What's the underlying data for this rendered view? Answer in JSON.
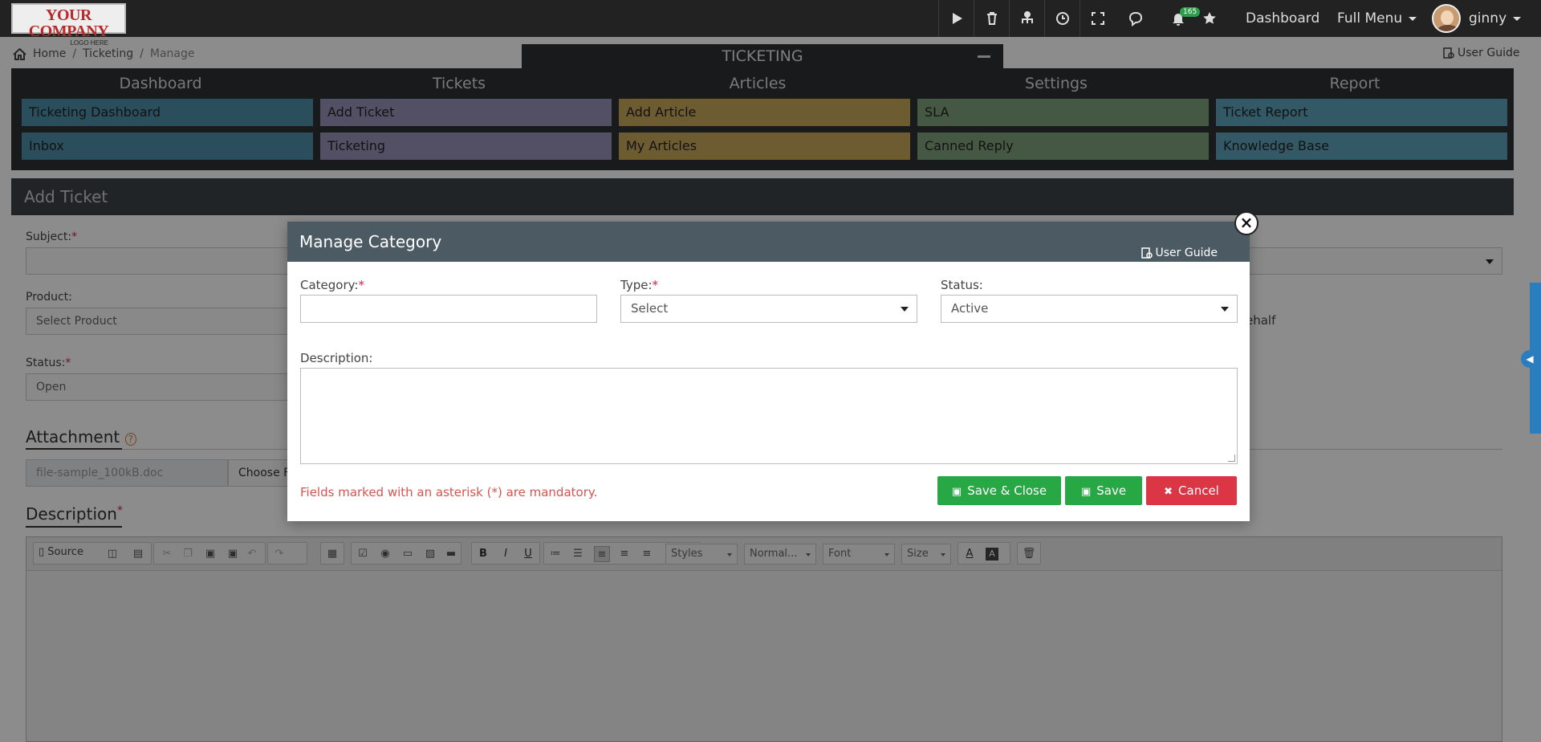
{
  "topbar": {
    "logo_line1": "YOUR COMPANY",
    "logo_line2": "LOGO HERE",
    "notification_count": "165",
    "dashboard_link": "Dashboard",
    "full_menu": "Full Menu",
    "username": "ginny"
  },
  "breadcrumb": {
    "home": "Home",
    "ticketing": "Ticketing",
    "current": "Manage"
  },
  "user_guide": "User Guide",
  "module_title": "TICKETING",
  "menu": {
    "columns": [
      "Dashboard",
      "Tickets",
      "Articles",
      "Settings",
      "Report"
    ],
    "items": [
      [
        "Ticketing Dashboard",
        "Inbox"
      ],
      [
        "Add Ticket",
        "Ticketing"
      ],
      [
        "Add Article",
        "My Articles"
      ],
      [
        "SLA",
        "Canned Reply"
      ],
      [
        "Ticket Report",
        "Knowledge Base"
      ]
    ],
    "colors": [
      "#4f8ea8",
      "#9891b8",
      "#c6a85b",
      "#7ea17b",
      "#5ba3b8"
    ]
  },
  "form": {
    "title": "Add Ticket",
    "subject_label": "Subject:",
    "product_label": "Product:",
    "product_placeholder": "Select Product",
    "status_label": "Status:",
    "status_value": "Open",
    "behalf_text": "ehalf",
    "attachment_title": "Attachment",
    "file_name": "file-sample_100kB.doc",
    "choose_label": "Choose F",
    "description_title": "Description",
    "asterisk": "*"
  },
  "editor": {
    "source_label": "Source",
    "styles": "Styles",
    "format": "Normal...",
    "font": "Font",
    "size": "Size"
  },
  "modal": {
    "title": "Manage Category",
    "user_guide": "User Guide",
    "category_label": "Category:",
    "type_label": "Type:",
    "type_value": "Select",
    "status_label": "Status:",
    "status_value": "Active",
    "description_label": "Description:",
    "mandatory_note": "Fields marked with an asterisk (*) are mandatory.",
    "save_close": "Save & Close",
    "save": "Save",
    "cancel": "Cancel",
    "asterisk": "*"
  }
}
